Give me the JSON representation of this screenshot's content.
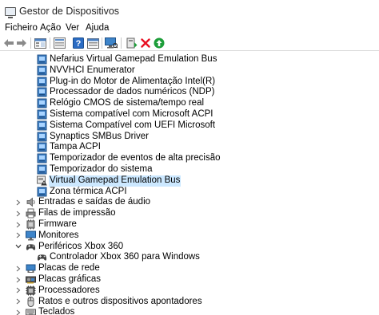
{
  "window": {
    "title": "Gestor de Dispositivos"
  },
  "menu": [
    "Ficheiro",
    "Ação",
    "Ver",
    "Ajuda"
  ],
  "toolbar": {
    "icons": [
      "back-arrow-icon",
      "forward-arrow-icon",
      "device-view-icon",
      "properties-icon",
      "help-icon",
      "resources-view-icon",
      "scan-hardware-icon",
      "update-driver-icon",
      "uninstall-device-icon",
      "enable-device-icon"
    ]
  },
  "tree": {
    "rows": [
      {
        "label": "Nefarius Virtual Gamepad Emulation Bus",
        "level": 2,
        "icon": "system-device-icon"
      },
      {
        "label": "NVVHCI Enumerator",
        "level": 2,
        "icon": "system-device-icon"
      },
      {
        "label": "Plug-in do Motor de Alimentação Intel(R)",
        "level": 2,
        "icon": "system-device-icon"
      },
      {
        "label": "Processador de dados numéricos (NDP)",
        "level": 2,
        "icon": "system-device-icon"
      },
      {
        "label": "Relógio CMOS de sistema/tempo real",
        "level": 2,
        "icon": "system-device-icon"
      },
      {
        "label": "Sistema compatível com Microsoft ACPI",
        "level": 2,
        "icon": "system-device-icon"
      },
      {
        "label": "Sistema Compatível com UEFI Microsoft",
        "level": 2,
        "icon": "system-device-icon"
      },
      {
        "label": "Synaptics SMBus Driver",
        "level": 2,
        "icon": "system-device-icon"
      },
      {
        "label": "Tampa ACPI",
        "level": 2,
        "icon": "system-device-icon"
      },
      {
        "label": "Temporizador de eventos de alta precisão",
        "level": 2,
        "icon": "system-device-icon"
      },
      {
        "label": "Temporizador do sistema",
        "level": 2,
        "icon": "system-device-icon"
      },
      {
        "label": "Virtual Gamepad Emulation Bus",
        "level": 2,
        "icon": "warning-device-icon",
        "selected": true
      },
      {
        "label": "Zona térmica ACPI",
        "level": 2,
        "icon": "system-device-icon"
      },
      {
        "label": "Entradas e saídas de áudio",
        "level": 1,
        "icon": "speaker-icon",
        "expander": "collapsed"
      },
      {
        "label": "Filas de impressão",
        "level": 1,
        "icon": "printer-icon",
        "expander": "collapsed"
      },
      {
        "label": "Firmware",
        "level": 1,
        "icon": "firmware-icon",
        "expander": "collapsed"
      },
      {
        "label": "Monitores",
        "level": 1,
        "icon": "monitor-icon",
        "expander": "collapsed"
      },
      {
        "label": "Periféricos Xbox 360",
        "level": 1,
        "icon": "gamepad-icon",
        "expander": "expanded"
      },
      {
        "label": "Controlador Xbox 360 para Windows",
        "level": 2,
        "icon": "gamepad-icon"
      },
      {
        "label": "Placas de rede",
        "level": 1,
        "icon": "network-adapter-icon",
        "expander": "collapsed"
      },
      {
        "label": "Placas gráficas",
        "level": 1,
        "icon": "display-adapter-icon",
        "expander": "collapsed"
      },
      {
        "label": "Processadores",
        "level": 1,
        "icon": "processor-icon",
        "expander": "collapsed"
      },
      {
        "label": "Ratos e outros dispositivos apontadores",
        "level": 1,
        "icon": "mouse-icon",
        "expander": "collapsed"
      },
      {
        "label": "Teclados",
        "level": 1,
        "icon": "keyboard-icon",
        "expander": "collapsed"
      }
    ]
  },
  "colors": {
    "selection": "#cce8ff",
    "uninstall": "#e81123",
    "enable": "#1e9e3a",
    "help": "#2b6cc4"
  }
}
